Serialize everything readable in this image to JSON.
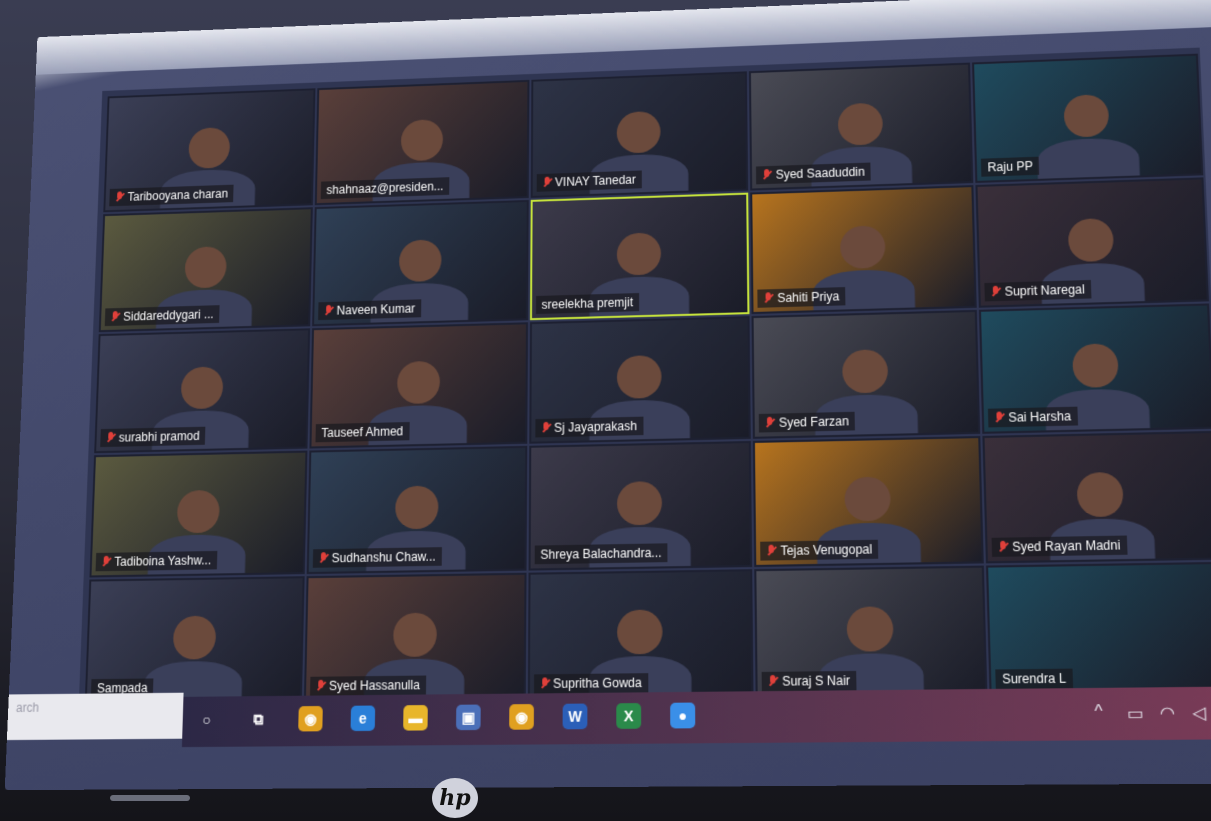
{
  "meeting": {
    "participants": [
      {
        "name": "Taribooyana charan",
        "muted": true
      },
      {
        "name": "shahnaaz@presiden...",
        "muted": false
      },
      {
        "name": "VINAY Tanedar",
        "muted": true
      },
      {
        "name": "Syed Saaduddin",
        "muted": true
      },
      {
        "name": "Raju PP",
        "muted": false
      },
      {
        "name": "Siddareddygari ...",
        "muted": true
      },
      {
        "name": "Naveen Kumar",
        "muted": true
      },
      {
        "name": "sreelekha premjit",
        "muted": false,
        "active": true
      },
      {
        "name": "Sahiti Priya",
        "muted": true
      },
      {
        "name": "Suprit Naregal",
        "muted": true
      },
      {
        "name": "surabhi pramod",
        "muted": true
      },
      {
        "name": "Tauseef Ahmed",
        "muted": false
      },
      {
        "name": "Sj Jayaprakash",
        "muted": true
      },
      {
        "name": "Syed Farzan",
        "muted": true
      },
      {
        "name": "Sai Harsha",
        "muted": true
      },
      {
        "name": "Tadiboina Yashw...",
        "muted": true
      },
      {
        "name": "Sudhanshu Chaw...",
        "muted": true
      },
      {
        "name": "Shreya Balachandra...",
        "muted": false
      },
      {
        "name": "Tejas Venugopal",
        "muted": true
      },
      {
        "name": "Syed Rayan Madni",
        "muted": true
      },
      {
        "name": "Sampada",
        "muted": false
      },
      {
        "name": "Syed Hassanulla",
        "muted": true
      },
      {
        "name": "Supritha Gowda",
        "muted": true
      },
      {
        "name": "Suraj S Nair",
        "muted": true
      },
      {
        "name": "Surendra L",
        "muted": false
      }
    ]
  },
  "taskbar": {
    "search_placeholder": "arch",
    "icons": [
      "cortana-icon",
      "task-view-icon",
      "chrome-icon",
      "edge-icon",
      "file-explorer-icon",
      "store-icon",
      "chrome-icon",
      "word-icon",
      "excel-icon",
      "zoom-icon"
    ],
    "tray": [
      "chevron-up-icon",
      "battery-icon",
      "wifi-icon",
      "speaker-icon"
    ]
  },
  "laptop": {
    "brand": "hp"
  },
  "colors": {
    "active_border": "#c6e33c",
    "muted_icon": "#e0403a",
    "taskbar_start": "#2c2846",
    "taskbar_end": "#7a3b57"
  }
}
